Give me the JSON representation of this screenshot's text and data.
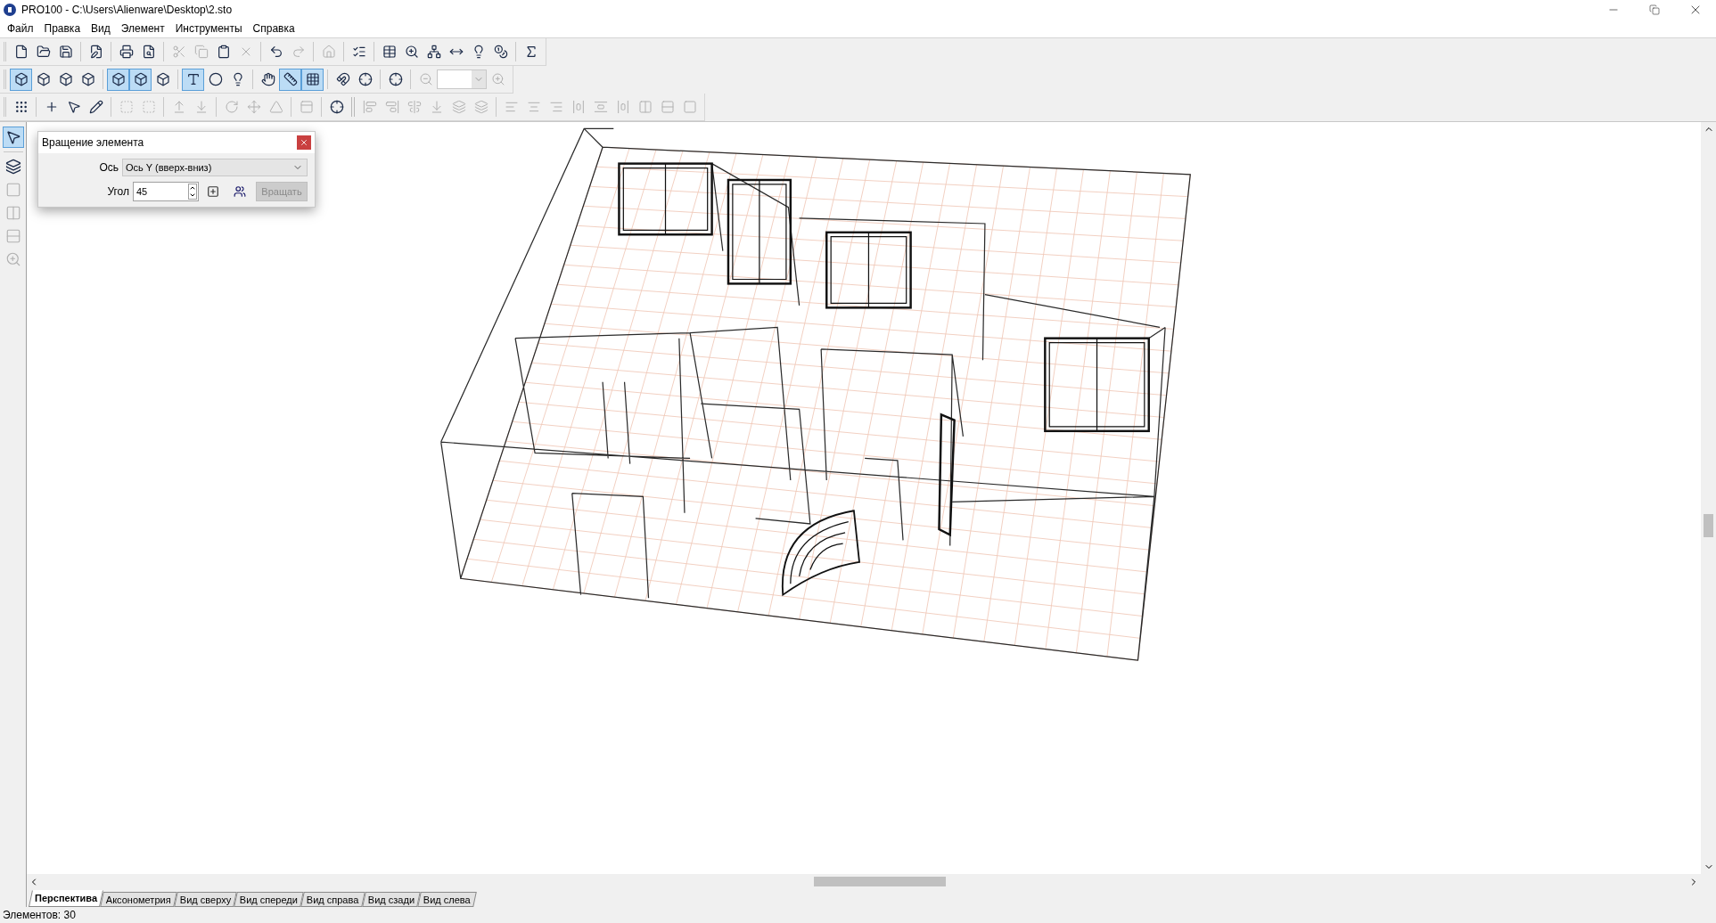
{
  "window": {
    "title": "PRO100 - C:\\Users\\Alienware\\Desktop\\2.sto"
  },
  "menu": [
    "Файл",
    "Правка",
    "Вид",
    "Элемент",
    "Инструменты",
    "Справка"
  ],
  "toolbars": [
    [
      [
        {
          "kind": "button",
          "pressed": false,
          "disabled": false
        },
        {
          "kind": "button",
          "pressed": false,
          "disabled": false
        },
        {
          "kind": "button",
          "pressed": false,
          "disabled": false
        }
      ],
      [
        {
          "kind": "button",
          "pressed": false,
          "disabled": false
        }
      ],
      [
        {
          "kind": "button",
          "pressed": false,
          "disabled": false
        },
        {
          "kind": "button",
          "pressed": false,
          "disabled": false
        }
      ],
      [
        {
          "kind": "button",
          "pressed": false,
          "disabled": true
        },
        {
          "kind": "button",
          "pressed": false,
          "disabled": true
        },
        {
          "kind": "button",
          "pressed": false,
          "disabled": false
        },
        {
          "kind": "button",
          "pressed": false,
          "disabled": true
        }
      ],
      [
        {
          "kind": "button",
          "pressed": false,
          "disabled": false
        },
        {
          "kind": "button",
          "pressed": false,
          "disabled": true
        }
      ],
      [
        {
          "kind": "button",
          "pressed": false,
          "disabled": true
        }
      ],
      [
        {
          "kind": "button",
          "pressed": false,
          "disabled": false
        }
      ],
      [
        {
          "kind": "button",
          "pressed": false,
          "disabled": false
        },
        {
          "kind": "button",
          "pressed": false,
          "disabled": false
        },
        {
          "kind": "button",
          "pressed": false,
          "disabled": false
        },
        {
          "kind": "button",
          "pressed": false,
          "disabled": false
        },
        {
          "kind": "button",
          "pressed": false,
          "disabled": false
        },
        {
          "kind": "button",
          "pressed": false,
          "disabled": false
        }
      ],
      [
        {
          "kind": "button",
          "pressed": false,
          "disabled": false
        }
      ]
    ],
    [
      [
        {
          "kind": "button",
          "pressed": true,
          "disabled": false
        },
        {
          "kind": "button",
          "pressed": false,
          "disabled": false
        },
        {
          "kind": "button",
          "pressed": false,
          "disabled": false
        },
        {
          "kind": "button",
          "pressed": false,
          "disabled": false
        }
      ],
      [
        {
          "kind": "button",
          "pressed": true,
          "disabled": false
        },
        {
          "kind": "button",
          "pressed": true,
          "disabled": false
        },
        {
          "kind": "button",
          "pressed": false,
          "disabled": false
        }
      ],
      [
        {
          "kind": "button",
          "pressed": true,
          "disabled": false
        },
        {
          "kind": "button",
          "pressed": false,
          "disabled": false
        },
        {
          "kind": "button",
          "pressed": false,
          "disabled": false
        }
      ],
      [
        {
          "kind": "button",
          "pressed": false,
          "disabled": false
        },
        {
          "kind": "button",
          "pressed": true,
          "disabled": false
        },
        {
          "kind": "button",
          "pressed": true,
          "disabled": false
        }
      ],
      [
        {
          "kind": "button",
          "pressed": false,
          "disabled": false
        },
        {
          "kind": "button",
          "pressed": false,
          "disabled": false
        }
      ],
      [
        {
          "kind": "button",
          "pressed": false,
          "disabled": false
        }
      ],
      [
        {
          "kind": "button",
          "pressed": false,
          "disabled": true
        },
        {
          "kind": "combo",
          "disabled": true
        },
        {
          "kind": "button",
          "pressed": false,
          "disabled": true
        }
      ]
    ],
    [
      [
        {
          "kind": "button",
          "pressed": false,
          "disabled": false
        }
      ],
      [
        {
          "kind": "button",
          "pressed": false,
          "disabled": false
        },
        {
          "kind": "button",
          "pressed": false,
          "disabled": false
        },
        {
          "kind": "button",
          "pressed": false,
          "disabled": false
        }
      ],
      [
        {
          "kind": "button",
          "pressed": false,
          "disabled": true
        },
        {
          "kind": "button",
          "pressed": false,
          "disabled": true
        }
      ],
      [
        {
          "kind": "button",
          "pressed": false,
          "disabled": true
        },
        {
          "kind": "button",
          "pressed": false,
          "disabled": true
        }
      ],
      [
        {
          "kind": "button",
          "pressed": false,
          "disabled": true
        },
        {
          "kind": "button",
          "pressed": false,
          "disabled": true
        },
        {
          "kind": "button",
          "pressed": false,
          "disabled": true
        }
      ],
      [
        {
          "kind": "button",
          "pressed": false,
          "disabled": true
        }
      ],
      [
        {
          "kind": "button",
          "pressed": false,
          "disabled": false
        }
      ],
      [
        {
          "kind": "button",
          "pressed": false,
          "disabled": true
        },
        {
          "kind": "button",
          "pressed": false,
          "disabled": true
        },
        {
          "kind": "button",
          "pressed": false,
          "disabled": true
        },
        {
          "kind": "button",
          "pressed": false,
          "disabled": true
        },
        {
          "kind": "button",
          "pressed": false,
          "disabled": true
        },
        {
          "kind": "button",
          "pressed": false,
          "disabled": true
        }
      ],
      [
        {
          "kind": "button",
          "pressed": false,
          "disabled": true
        },
        {
          "kind": "button",
          "pressed": false,
          "disabled": true
        },
        {
          "kind": "button",
          "pressed": false,
          "disabled": true
        },
        {
          "kind": "button",
          "pressed": false,
          "disabled": true
        },
        {
          "kind": "button",
          "pressed": false,
          "disabled": true
        },
        {
          "kind": "button",
          "pressed": false,
          "disabled": true
        },
        {
          "kind": "button",
          "pressed": false,
          "disabled": true
        },
        {
          "kind": "button",
          "pressed": false,
          "disabled": true
        },
        {
          "kind": "button",
          "pressed": false,
          "disabled": true
        }
      ]
    ]
  ],
  "left_toolbar": [
    [
      {
        "kind": "button",
        "pressed": true,
        "disabled": false
      }
    ],
    [
      {
        "kind": "button",
        "pressed": false,
        "disabled": false
      },
      {
        "kind": "button",
        "pressed": false,
        "disabled": true
      },
      {
        "kind": "button",
        "pressed": false,
        "disabled": true
      },
      {
        "kind": "button",
        "pressed": false,
        "disabled": true
      },
      {
        "kind": "button",
        "pressed": false,
        "disabled": true
      }
    ]
  ],
  "rotate_dialog": {
    "title": "Вращение элемента",
    "axis_label": "Ось",
    "axis_value": "Ось Y (вверх-вниз)",
    "angle_label": "Угол",
    "angle_value": "45",
    "rotate_button": {
      "label": "Вращать",
      "disabled": true
    }
  },
  "view_tabs": [
    {
      "label": "Перспектива",
      "selected": true
    },
    {
      "label": "Аксонометрия",
      "selected": false
    },
    {
      "label": "Вид сверху",
      "selected": false
    },
    {
      "label": "Вид спереди",
      "selected": false
    },
    {
      "label": "Вид справа",
      "selected": false
    },
    {
      "label": "Вид сзади",
      "selected": false
    },
    {
      "label": "Вид слева",
      "selected": false
    }
  ],
  "status_bar": "Элементов: 30"
}
